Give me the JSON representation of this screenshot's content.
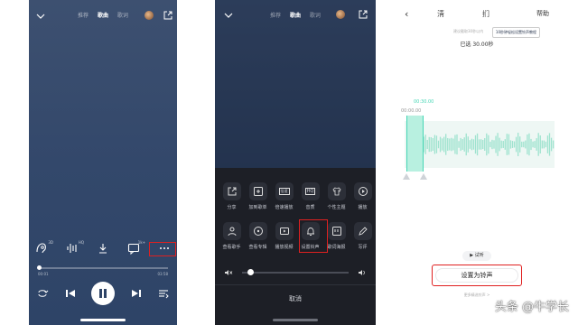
{
  "screen1": {
    "tabs": [
      "推荐",
      "歌曲",
      "歌词"
    ],
    "active_tab": "歌曲",
    "icons": [
      "sound-effect-icon",
      "audio-mode-icon",
      "download-icon",
      "comment-icon",
      "more-icon"
    ],
    "badges": {
      "sound_effect": "3D",
      "audio_mode": "HQ",
      "comment": "1k+"
    },
    "time_current": "00:01",
    "time_total": "03:58",
    "progress": 0.01,
    "highlight_color": "#e02020"
  },
  "screen2": {
    "tabs": [
      "推荐",
      "歌曲",
      "歌词"
    ],
    "active_tab": "歌曲",
    "row1": [
      {
        "label": "分享",
        "icon": "share-icon"
      },
      {
        "label": "加到歌单",
        "icon": "add-to-playlist-icon"
      },
      {
        "label": "倍速播放",
        "icon": "speed-icon",
        "glyph": "倍速"
      },
      {
        "label": "音质",
        "icon": "hq-icon",
        "glyph": "HQ"
      },
      {
        "label": "个性主题",
        "icon": "tshirt-icon"
      },
      {
        "label": "播放",
        "icon": "play-video-icon"
      }
    ],
    "row2": [
      {
        "label": "查看歌手",
        "icon": "singer-icon"
      },
      {
        "label": "查看专辑",
        "icon": "album-icon"
      },
      {
        "label": "播放视频",
        "icon": "video-icon"
      },
      {
        "label": "设置铃声",
        "icon": "bell-icon"
      },
      {
        "label": "歌词海报",
        "icon": "lyric-poster-icon"
      },
      {
        "label": "写评",
        "icon": "write-icon"
      }
    ],
    "cancel_label": "取消"
  },
  "screen3": {
    "back_icon": "back-icon",
    "title_left": "淸",
    "title_right": "扪",
    "help_label": "帮助",
    "hint": "建议截取30秒以内",
    "tutorial_label": "10秒钟轻松设置铃声教程",
    "selected": "已选 30.00秒",
    "start_time": "00:30.00",
    "zero_time": "00:00.00",
    "trial_label": "▶ 试听",
    "set_button": "设置为铃声",
    "more_link": "更多精选铃声 >",
    "accent_color": "#46d6b5"
  },
  "watermark": "头条 @牛学长"
}
